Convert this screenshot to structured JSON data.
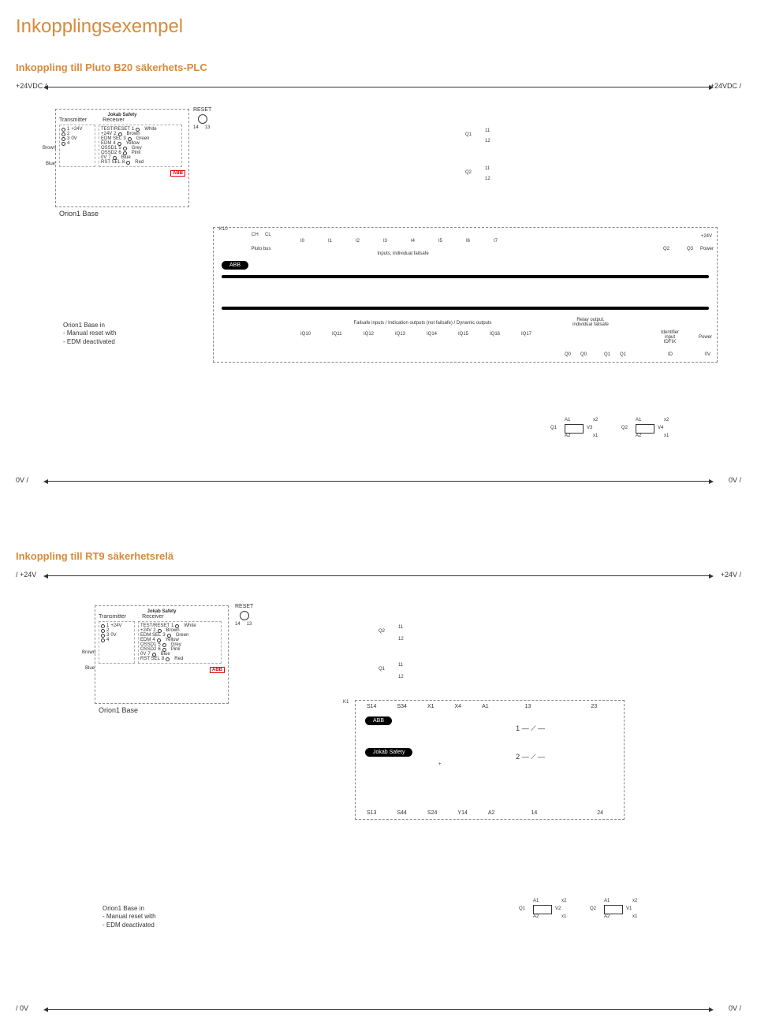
{
  "page": {
    "title": "Inkopplingsexempel",
    "section1": "Inkoppling till Pluto B20 säkerhets-PLC",
    "section2": "Inkoppling till RT9 säkerhetsrelä"
  },
  "rails": {
    "p24vdc": "+24VDC /",
    "p24v": "+24V /",
    "zero": "0V /",
    "zero_slash": "/ 0V",
    "p24v_slash": "/ +24V"
  },
  "orion": {
    "brand": "Jokab Safety",
    "tx": "Transmitter",
    "rx": "Receiver",
    "name": "Orion1 Base",
    "tx_pins": [
      {
        "n": "1",
        "label": "+24V"
      },
      {
        "n": "2",
        "label": ""
      },
      {
        "n": "3",
        "label": "0V"
      },
      {
        "n": "4",
        "label": ""
      }
    ],
    "tx_colors": {
      "top": "Brown",
      "bottom": "Blue"
    },
    "rx_pins": [
      {
        "n": "1",
        "label": "TEST/RESET",
        "color": "White"
      },
      {
        "n": "2",
        "label": "+24V",
        "color": "Brown"
      },
      {
        "n": "3",
        "label": "EDM SEL",
        "color": "Green"
      },
      {
        "n": "4",
        "label": "EDM",
        "color": "Yellow"
      },
      {
        "n": "5",
        "label": "OSSD1",
        "color": "Grey"
      },
      {
        "n": "6",
        "label": "OSSD2",
        "color": "Pink"
      },
      {
        "n": "7",
        "label": "0V",
        "color": "Blue"
      },
      {
        "n": "8",
        "label": "RST SEL",
        "color": "Red"
      }
    ],
    "abb": "ABB",
    "reset": "RESET",
    "reset_terminals": [
      "14",
      "13"
    ]
  },
  "note": {
    "line1": "Orion1 Base in",
    "line2": "- Manual reset with",
    "line3": "- EDM deactivated"
  },
  "pluto": {
    "k10": "K10",
    "bus_terms": [
      "CH",
      "CL"
    ],
    "bus_label": "Pluto bus",
    "inputs_label": "Inputs, individual failsafe",
    "inputs": [
      "I0",
      "I1",
      "I2",
      "I3",
      "I4",
      "I5",
      "I6",
      "I7"
    ],
    "abb": "ABB",
    "q_contacts_top": [
      {
        "name": "Q1",
        "t": [
          "11",
          "12"
        ]
      },
      {
        "name": "Q2",
        "t": [
          "11",
          "12"
        ]
      }
    ],
    "power_top": {
      "q": [
        "Q2",
        "Q3"
      ],
      "label": "Power",
      "v": "+24V"
    },
    "failsafe_label": "Failsafe inputs / Indication outputs (not failsafe) / Dynamic outputs",
    "iq": [
      "IQ10",
      "IQ11",
      "IQ12",
      "IQ13",
      "IQ14",
      "IQ15",
      "IQ16",
      "IQ17"
    ],
    "relay_out_label": "Relay output,\nindividual failsafe",
    "q_bottom": [
      "Q0",
      "Q0",
      "Q1",
      "Q1"
    ],
    "idfix": "Identifier\ninput\nIDFIX",
    "power_b": "Power",
    "id_term": "ID",
    "zero_term": "0V"
  },
  "output_coils": {
    "s1": [
      {
        "c": "Q1",
        "r": "V3",
        "t": [
          "A1",
          "A2",
          "x1",
          "x2"
        ]
      },
      {
        "c": "Q2",
        "r": "V4",
        "t": [
          "A1",
          "A2",
          "x1",
          "x2"
        ]
      }
    ],
    "s2": [
      {
        "c": "Q1",
        "r": "V2",
        "t": [
          "A1",
          "A2",
          "x1",
          "x2"
        ]
      },
      {
        "c": "Q2",
        "r": "V1",
        "t": [
          "A1",
          "A2",
          "x1",
          "x2"
        ]
      }
    ]
  },
  "rt9": {
    "q_contacts": [
      {
        "name": "Q2",
        "t": [
          "11",
          "12"
        ]
      },
      {
        "name": "Q1",
        "t": [
          "11",
          "12"
        ]
      }
    ],
    "k1": "K1",
    "top_terms": [
      "S14",
      "S34",
      "X1",
      "X4",
      "A1",
      "13",
      "23"
    ],
    "bottom_terms": [
      "S13",
      "S44",
      "S24",
      "Y14",
      "A2",
      "14",
      "24"
    ],
    "abb": "ABB",
    "jokab": "Jokab Safety",
    "contacts": [
      "1",
      "2"
    ],
    "plus": "+"
  }
}
